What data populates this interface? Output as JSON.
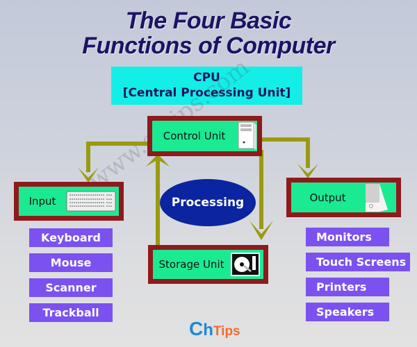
{
  "title": {
    "line1": "The Four Basic",
    "line2": "Functions of Computer"
  },
  "cpu": {
    "line1": "CPU",
    "line2": "[Central Processing Unit]"
  },
  "units": {
    "control": {
      "label": "Control Unit",
      "icon": "computer-tower-icon"
    },
    "input": {
      "label": "Input",
      "icon": "keyboard-icon"
    },
    "output": {
      "label": "Output",
      "icon": "printer-icon"
    },
    "storage": {
      "label": "Storage Unit",
      "icon": "hard-disk-icon"
    }
  },
  "processing": {
    "label": "Processing"
  },
  "input_devices": [
    "Keyboard",
    "Mouse",
    "Scanner",
    "Trackball"
  ],
  "output_devices": [
    "Monitors",
    "Touch Screens",
    "Printers",
    "Speakers"
  ],
  "watermark": "www.chtips.com",
  "logo": {
    "c": "C",
    "h": "h",
    "tips": "Tips"
  },
  "colors": {
    "title": "#1b1464",
    "cpu_bg": "#13eee7",
    "unit_border": "#8e1a1c",
    "unit_fill": "#1cea93",
    "pill": "#7b52f0",
    "processing": "#0a259f",
    "arrow": "#9a9a10"
  }
}
